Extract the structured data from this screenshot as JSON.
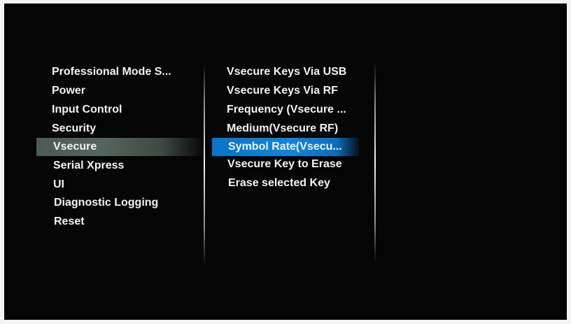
{
  "left_menu": {
    "items": [
      {
        "label": "Professional Mode S..."
      },
      {
        "label": "Power"
      },
      {
        "label": "Input Control"
      },
      {
        "label": "Security"
      },
      {
        "label": "Vsecure"
      },
      {
        "label": "Serial Xpress"
      },
      {
        "label": "UI"
      },
      {
        "label": "Diagnostic Logging"
      },
      {
        "label": "Reset"
      }
    ],
    "selected": "Vsecure"
  },
  "sub_menu": {
    "items": [
      {
        "label": "Vsecure Keys Via USB"
      },
      {
        "label": "Vsecure Keys Via RF"
      },
      {
        "label": "Frequency (Vsecure ..."
      },
      {
        "label": "Medium(Vsecure RF)"
      },
      {
        "label": "Symbol Rate(Vsecu..."
      },
      {
        "label": "Vsecure Key to Erase"
      },
      {
        "label": "Erase selected Key"
      }
    ],
    "selected": "Symbol Rate(Vsecu..."
  },
  "colors": {
    "background": "#050505",
    "text": "#f2f2f2",
    "highlight_blue": "#0f86dc",
    "highlight_grey": "#56645e"
  }
}
